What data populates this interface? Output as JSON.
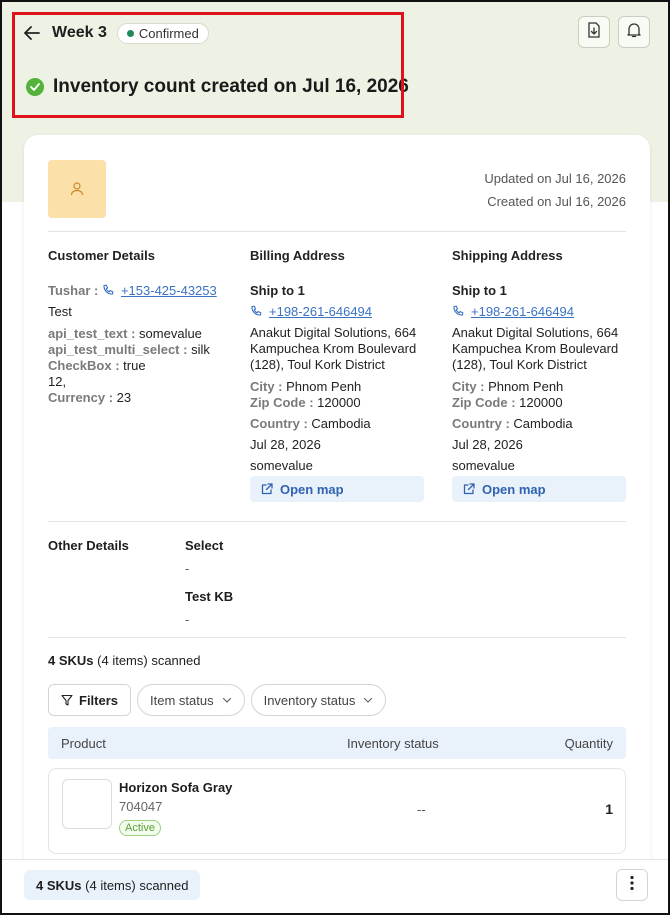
{
  "header": {
    "title": "Week 3",
    "status": "Confirmed",
    "colors": {
      "status_dot": "#1f8a5b",
      "top_band": "#eef2e5",
      "highlight": "#e0121a"
    }
  },
  "banner": {
    "message": "Inventory count created on Jul 16, 2026"
  },
  "meta": {
    "updated": "Updated on Jul 16, 2026",
    "created": "Created on Jul 16, 2026"
  },
  "customer": {
    "title": "Customer Details",
    "name_label": "Tushar :",
    "phone": "+153-425-43253",
    "extra_name": "Test",
    "api_test_text_key": "api_test_text :",
    "api_test_text_val": "somevalue",
    "api_multi_key": "api_test_multi_select :",
    "api_multi_val": "silk",
    "checkbox_key": "CheckBox :",
    "checkbox_val": "true",
    "number_line": "12,",
    "currency_key": "Currency :",
    "currency_val": "23"
  },
  "billing": {
    "title": "Billing Address",
    "ship_to": "Ship to 1",
    "phone": "+198-261-646494",
    "address": "Anakut Digital Solutions, 664 Kampuchea Krom Boulevard (128), Toul Kork District",
    "city_key": "City :",
    "city_val": "Phnom Penh",
    "zip_key": "Zip Code :",
    "zip_val": "120000",
    "country_key": "Country :",
    "country_val": "Cambodia",
    "date": "Jul 28, 2026",
    "note": "somevalue",
    "map_label": "Open map"
  },
  "shipping": {
    "title": "Shipping Address",
    "ship_to": "Ship to 1",
    "phone": "+198-261-646494",
    "address": "Anakut Digital Solutions, 664 Kampuchea Krom Boulevard (128), Toul Kork District",
    "city_key": "City :",
    "city_val": "Phnom Penh",
    "zip_key": "Zip Code :",
    "zip_val": "120000",
    "country_key": "Country :",
    "country_val": "Cambodia",
    "date": "Jul 28, 2026",
    "note": "somevalue",
    "map_label": "Open map"
  },
  "other": {
    "title": "Other Details",
    "fields": [
      {
        "label": "Select",
        "value": "-"
      },
      {
        "label": "Test KB",
        "value": "-"
      }
    ]
  },
  "skus": {
    "count": "4 SKUs",
    "suffix": "(4 items) scanned",
    "filters_label": "Filters",
    "item_status_label": "Item status",
    "inventory_status_label": "Inventory status",
    "columns": {
      "product": "Product",
      "inventory_status": "Inventory status",
      "quantity": "Quantity"
    },
    "rows": [
      {
        "name": "Horizon Sofa Gray",
        "sku": "704047",
        "badge": "Active",
        "inventory_status": "--",
        "quantity": "1"
      }
    ]
  },
  "footer": {
    "count": "4 SKUs",
    "suffix": "(4 items) scanned"
  }
}
